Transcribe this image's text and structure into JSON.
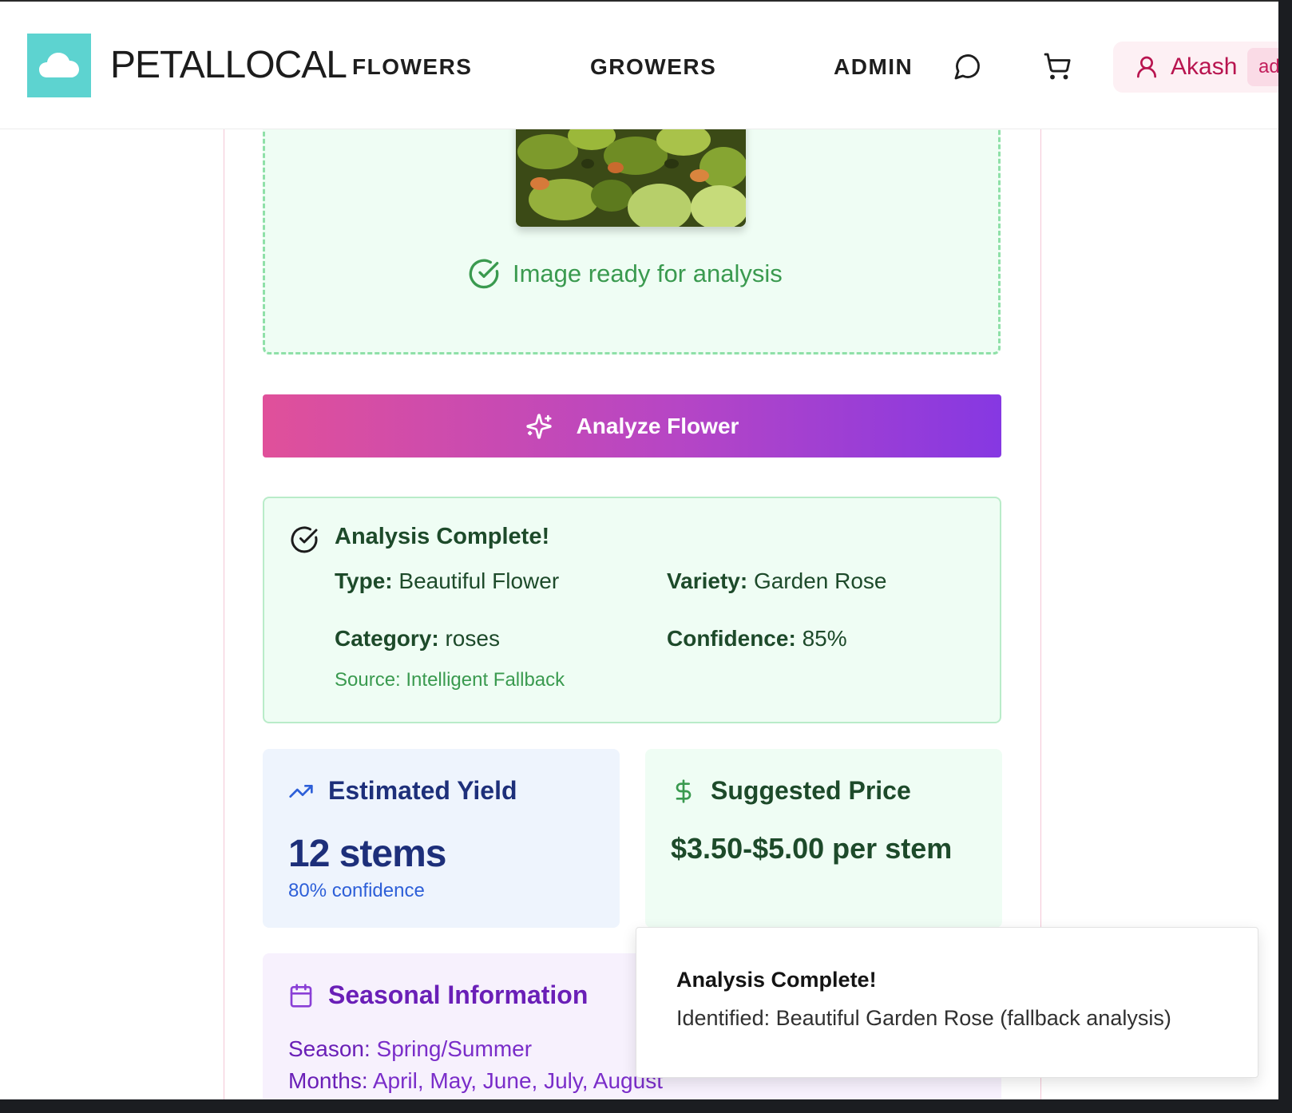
{
  "header": {
    "brand": "PETALLOCAL",
    "nav": {
      "flowers": "FLOWERS",
      "growers": "GROWERS",
      "admin": "ADMIN"
    },
    "user": {
      "name": "Akash",
      "role_badge": "ad"
    }
  },
  "upload": {
    "status": "Image ready for analysis"
  },
  "analyze_button": "Analyze Flower",
  "result": {
    "title": "Analysis Complete!",
    "type_label": "Type:",
    "type_value": "Beautiful Flower",
    "variety_label": "Variety:",
    "variety_value": "Garden Rose",
    "category_label": "Category:",
    "category_value": "roses",
    "confidence_label": "Confidence:",
    "confidence_value": "85%",
    "source": "Source: Intelligent Fallback"
  },
  "yield": {
    "title": "Estimated Yield",
    "value": "12 stems",
    "confidence": "80% confidence"
  },
  "price": {
    "title": "Suggested Price",
    "value": "$3.50-$5.00 per stem"
  },
  "season": {
    "title": "Seasonal Information",
    "season_label": "Season:",
    "season_value": "Spring/Summer",
    "months_label": "Months:",
    "months_value": "April, May, June, July, August"
  },
  "toast": {
    "title": "Analysis Complete!",
    "body": "Identified: Beautiful Garden Rose (fallback analysis)"
  },
  "colors": {
    "brand_teal": "#5dd3d0",
    "accent_pink": "#b8144f",
    "success_green": "#3a9a4f",
    "gradient_start": "#e0509a",
    "gradient_end": "#8638e2",
    "yield_blue": "#1d2f7a",
    "season_purple": "#7a2dc9"
  }
}
